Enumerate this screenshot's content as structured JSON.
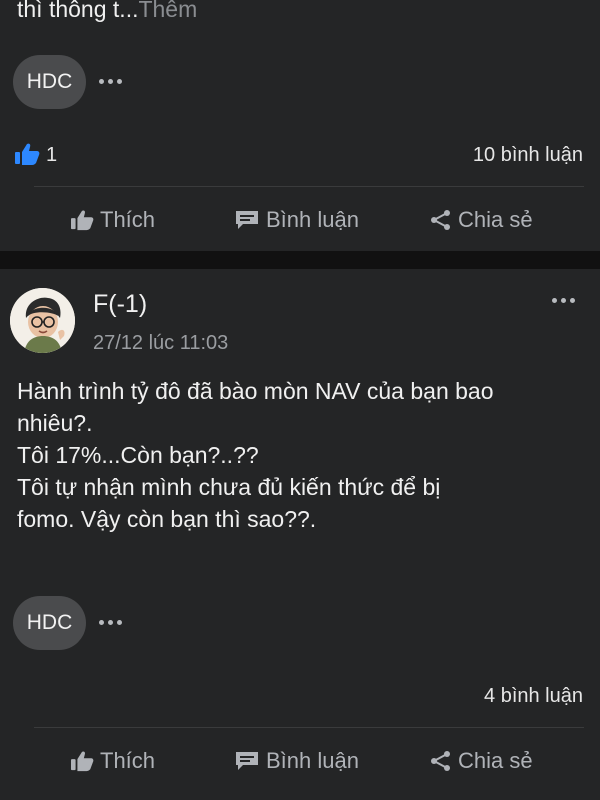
{
  "post1": {
    "text_tail": "thì thông t...",
    "more_label": "Thêm",
    "tag": "HDC",
    "like_count": "1",
    "comment_count": "10 bình luận",
    "actions": {
      "like": "Thích",
      "comment": "Bình luận",
      "share": "Chia sẻ"
    }
  },
  "post2": {
    "author": "F(-1)",
    "timestamp": "27/12 lúc 11:03",
    "lines": [
      "Hành trình tỷ đô đã bào mòn NAV của bạn bao",
      "nhiêu?.",
      "Tôi 17%...Còn bạn?..??",
      "Tôi tự nhận mình chưa đủ kiến thức để bị",
      "fomo. Vậy còn bạn thì sao??."
    ],
    "tag": "HDC",
    "comment_count": "4 bình luận",
    "actions": {
      "like": "Thích",
      "comment": "Bình luận",
      "share": "Chia sẻ"
    }
  },
  "colors": {
    "card_bg": "#242526",
    "page_bg": "#111111",
    "like_blue": "#2d88ff",
    "muted": "#b0b3b8"
  },
  "icons": [
    "like-blue-icon",
    "thumbs-up-icon",
    "comment-icon",
    "share-icon",
    "more-options-icon"
  ]
}
